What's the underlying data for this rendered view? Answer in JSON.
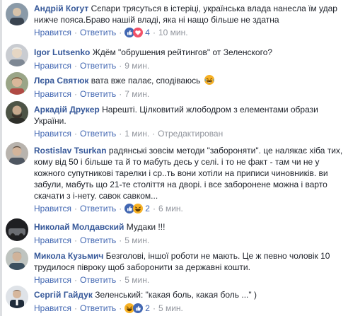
{
  "actions": {
    "like": "Нравится",
    "reply": "Ответить",
    "sep": "·",
    "edited": "Отредактирован"
  },
  "comments": [
    {
      "author": "Андрій Когут",
      "text": "Сєпари трясуться в істеріці, українська влада нанесла їм удар нижче пояса.Браво нашій владі, яка ні нащо більше не здатна",
      "reactions": "4",
      "reaction_types": [
        "like",
        "love"
      ],
      "time": "10 мин."
    },
    {
      "author": "Igor Lutsenko",
      "text": "Ждём \"обрушения рейтингов\" от Зеленского?",
      "reactions": "",
      "time": "9 мин."
    },
    {
      "author": "Лєра Святюк",
      "text": "вата вже палає, сподіваюсь",
      "text_emoji": "laugh",
      "reactions": "",
      "time": "7 мин."
    },
    {
      "author": "Аркадій Друкер",
      "text": "Нарешті. Цілковитий жлободром з елементами образи України.",
      "reactions": "",
      "time": "1 мин.",
      "edited": true
    },
    {
      "author": "Rostislav Tsurkan",
      "text": "радянські зовсім методи \"забороняти\". це налякає хіба тих, кому від 50 і більше та й то мабуть десь у селі. і то не факт - там чи не у кожного супутникові тарелки і ср..ть вони хотіли на приписи чиновників. ви забули, мабуть що 21-те століття на дворі. і все заборонене можна і варто скачати з і-нету. савок савком...",
      "reactions": "2",
      "reaction_types": [
        "like",
        "laugh"
      ],
      "time": "6 мин."
    },
    {
      "author": "Николай Молдавский",
      "text": "Мудаки !!!",
      "reactions": "",
      "time": "5 мин."
    },
    {
      "author": "Микола Кузьмич",
      "text": "Безголові, іншої роботи не мають. Це ж певно чоловік 10 трудилося півроку щоб заборонити за державні кошти.",
      "reactions": "",
      "time": "5 мин."
    },
    {
      "author": "Сергій Гайдук",
      "text": "Зеленський: \"какая боль, какая боль ...\" )",
      "reactions": "2",
      "reaction_types": [
        "laugh",
        "like"
      ],
      "time": "5 мин."
    }
  ],
  "colors": {
    "author": "#365899",
    "link": "#4267b2",
    "meta": "#90949c",
    "text": "#1d2129",
    "like_blue": "#4267b2",
    "love_red": "#f25268",
    "haha_yellow": "#f7b125"
  }
}
